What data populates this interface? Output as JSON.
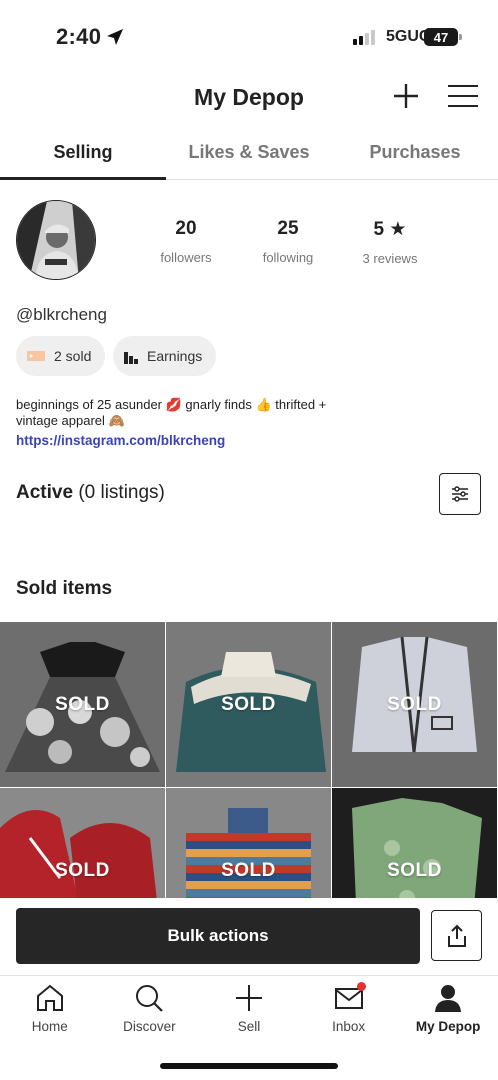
{
  "status_bar": {
    "time": "2:40",
    "network": "5GUC",
    "battery": "47"
  },
  "header": {
    "title": "My Depop"
  },
  "tabs": [
    {
      "label": "Selling",
      "active": true
    },
    {
      "label": "Likes & Saves",
      "active": false
    },
    {
      "label": "Purchases",
      "active": false
    }
  ],
  "profile": {
    "stats": [
      {
        "value": "20",
        "label": "followers"
      },
      {
        "value": "25",
        "label": "following"
      },
      {
        "value": "5 ★",
        "label": "3 reviews"
      }
    ],
    "username": "@blkrcheng",
    "sold_pill": "2 sold",
    "earnings_pill": "Earnings",
    "bio_line1": "beginnings of 25 asunder 💋 gnarly finds  👍 thrifted +",
    "bio_line2": "vintage apparel 🙈",
    "link": "https://instagram.com/blkrcheng"
  },
  "active_section": {
    "label": "Active",
    "count": "(0 listings)"
  },
  "sold_section": {
    "title": "Sold items",
    "badge": "SOLD",
    "items": [
      "SOLD",
      "SOLD",
      "SOLD",
      "SOLD",
      "SOLD",
      "SOLD"
    ]
  },
  "actions": {
    "bulk": "Bulk actions"
  },
  "nav": [
    {
      "label": "Home",
      "icon": "home-icon"
    },
    {
      "label": "Discover",
      "icon": "search-icon"
    },
    {
      "label": "Sell",
      "icon": "plus-icon"
    },
    {
      "label": "Inbox",
      "icon": "mail-icon"
    },
    {
      "label": "My Depop",
      "icon": "person-icon",
      "active": true
    }
  ],
  "colors": {
    "link": "#3b43b6",
    "notification": "#e8312f",
    "button": "#262626"
  }
}
